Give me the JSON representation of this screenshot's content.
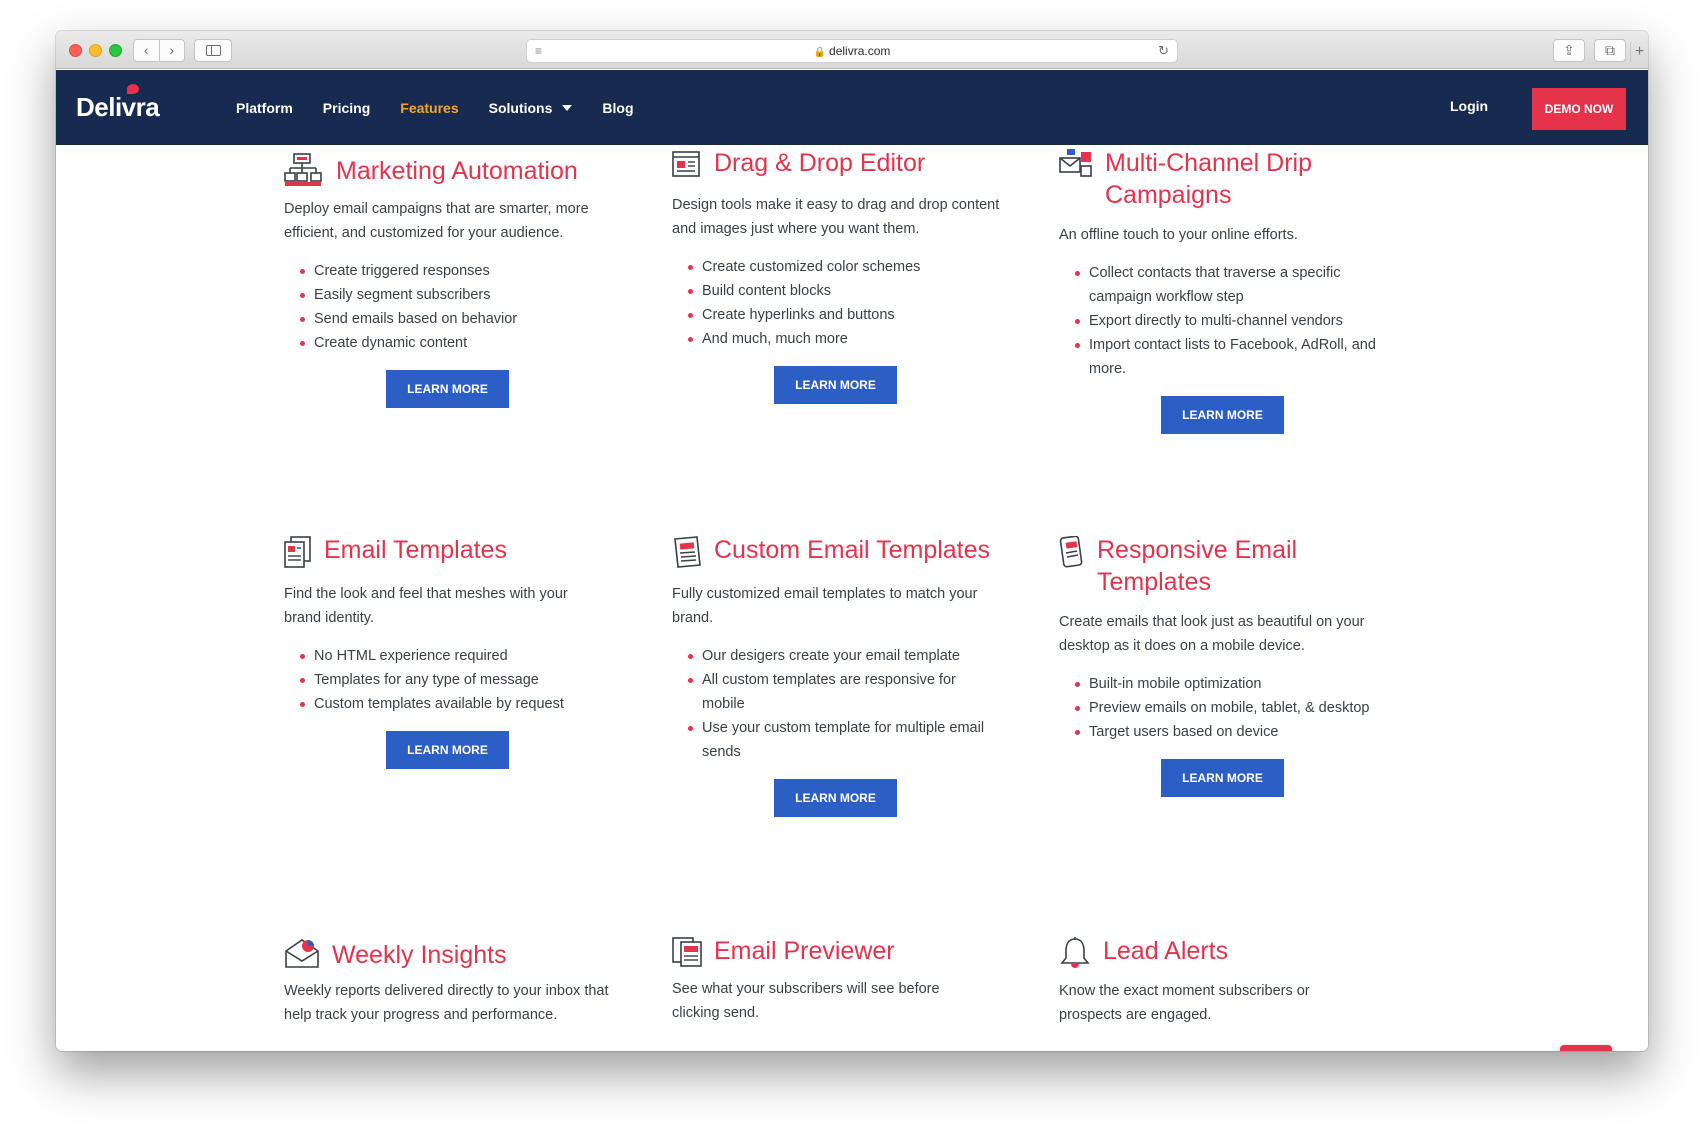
{
  "browser": {
    "url": "delivra.com",
    "back_glyph": "‹",
    "forward_glyph": "›",
    "reader_glyph": "≡",
    "reload_glyph": "↻",
    "share_glyph": "⇪",
    "tabs_glyph": "⧉",
    "newtab_glyph": "+"
  },
  "header": {
    "logo": "Delivra",
    "nav": [
      {
        "label": "Platform"
      },
      {
        "label": "Pricing"
      },
      {
        "label": "Features"
      },
      {
        "label": "Solutions"
      },
      {
        "label": "Blog"
      }
    ],
    "login": "Login",
    "demo": "DEMO NOW"
  },
  "cards": [
    {
      "title": "Marketing Automation",
      "icon": "automation-icon",
      "desc": "Deploy email campaigns that are smarter, more efficient, and customized for your audience.",
      "items": [
        "Create triggered responses",
        "Easily segment subscribers",
        "Send emails based on behavior",
        "Create dynamic content"
      ],
      "button": "LEARN MORE"
    },
    {
      "title": "Drag & Drop Editor",
      "icon": "editor-icon",
      "desc": "Design tools make it easy to drag and drop content and images just where you want them.",
      "items": [
        "Create customized color schemes",
        "Build content blocks",
        "Create hyperlinks and buttons",
        "And much, much more"
      ],
      "button": "LEARN MORE"
    },
    {
      "title": "Multi-Channel Drip Campaigns",
      "icon": "multichannel-icon",
      "desc": "An offline touch to your online efforts.",
      "items": [
        "Collect contacts that traverse a specific campaign workflow step",
        "Export directly to multi-channel vendors",
        "Import contact lists to Facebook, AdRoll, and more."
      ],
      "button": "LEARN MORE"
    },
    {
      "title": "Email Templates",
      "icon": "templates-icon",
      "desc": "Find the look and feel that meshes with your brand identity.",
      "items": [
        "No HTML experience required",
        "Templates for any type of message",
        "Custom templates available by request"
      ],
      "button": "LEARN MORE"
    },
    {
      "title": "Custom Email Templates",
      "icon": "custom-templates-icon",
      "desc": "Fully customized email templates to match your brand.",
      "items": [
        "Our desigers create your email template",
        "All custom templates are responsive for mobile",
        "Use your custom template for multiple email sends"
      ],
      "button": "LEARN MORE"
    },
    {
      "title": "Responsive Email Templates",
      "icon": "responsive-icon",
      "desc": "Create emails that look just as beautiful on your desktop as it does on a mobile device.",
      "items": [
        "Built-in mobile optimization",
        "Preview emails on mobile, tablet, & desktop",
        "Target users based on device"
      ],
      "button": "LEARN MORE"
    },
    {
      "title": "Weekly Insights",
      "icon": "insights-icon",
      "desc": "Weekly reports delivered directly to your inbox that help track your progress and performance."
    },
    {
      "title": "Email Previewer",
      "icon": "previewer-icon",
      "desc": "See what your subscribers will see before clicking send."
    },
    {
      "title": "Lead Alerts",
      "icon": "bell-icon",
      "desc": "Know the exact moment subscribers or prospects are engaged."
    }
  ],
  "colors": {
    "header_bg": "#172a50",
    "accent_red": "#e5334b",
    "active_nav": "#f5a623",
    "button_blue": "#2b5fc6"
  }
}
